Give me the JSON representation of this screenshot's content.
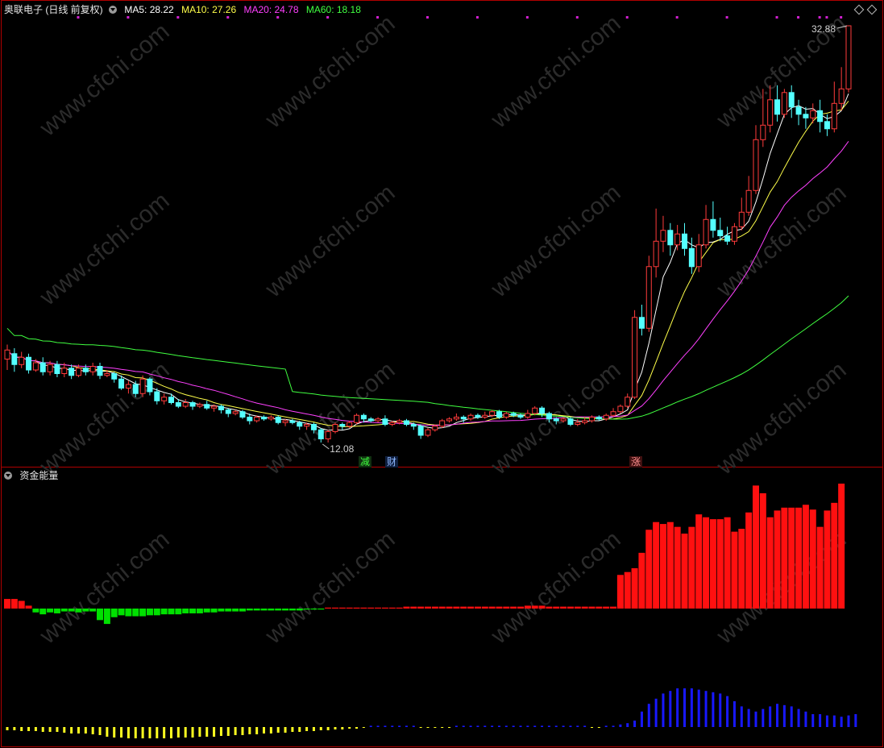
{
  "header": {
    "stock": "奥联电子 (日线 前复权)",
    "ma5": "MA5: 28.22",
    "ma10": "MA10: 27.26",
    "ma20": "MA20: 24.78",
    "ma60": "MA60: 18.18"
  },
  "indicator": {
    "title": "资金能量"
  },
  "annotations": {
    "high": "32.88",
    "low": "12.08"
  },
  "signals": [
    {
      "text": "减"
    },
    {
      "text": "财"
    },
    {
      "text": "涨"
    }
  ],
  "colors": {
    "up": "#ff3b3b",
    "down": "#54ffff",
    "ma5": "#ffffff",
    "ma10": "#ffff4a",
    "ma20": "#ff40ff",
    "ma60": "#40ff40",
    "frame": "#b00000",
    "energy_pos": "#ff1010",
    "energy_neg": "#00e000",
    "flow_blue": "#1818ff",
    "flow_yellow": "#ffff20"
  },
  "chart_data": {
    "type": "candlestick",
    "ylim": [
      12.08,
      32.88
    ],
    "candles": [
      [
        14.5,
        15.0,
        15.3,
        13.9
      ],
      [
        14.8,
        14.2,
        15.1,
        13.8
      ],
      [
        14.2,
        14.6,
        14.9,
        14.0
      ],
      [
        14.6,
        13.9,
        14.8,
        13.7
      ],
      [
        13.9,
        14.3,
        14.5,
        13.8
      ],
      [
        14.3,
        13.8,
        14.6,
        13.6
      ],
      [
        13.8,
        14.2,
        14.4,
        13.6
      ],
      [
        14.2,
        13.7,
        14.4,
        13.5
      ],
      [
        13.7,
        14.0,
        14.3,
        13.5
      ],
      [
        14.0,
        13.6,
        14.2,
        13.4
      ],
      [
        13.6,
        14.0,
        14.2,
        13.5
      ],
      [
        14.0,
        13.8,
        14.2,
        13.6
      ],
      [
        13.8,
        14.1,
        14.3,
        13.6
      ],
      [
        14.1,
        13.6,
        14.3,
        13.4
      ],
      [
        13.6,
        13.7,
        13.9,
        13.5
      ],
      [
        13.7,
        13.4,
        13.8,
        13.2
      ],
      [
        13.4,
        12.9,
        13.6,
        12.8
      ],
      [
        12.9,
        13.1,
        13.3,
        12.6
      ],
      [
        13.1,
        12.6,
        13.3,
        12.4
      ],
      [
        12.6,
        13.4,
        13.6,
        12.4
      ],
      [
        13.4,
        12.7,
        13.5,
        12.5
      ],
      [
        12.7,
        12.2,
        12.9,
        12.0
      ],
      [
        12.2,
        12.4,
        12.6,
        12.0
      ],
      [
        12.4,
        12.1,
        12.6,
        12.0
      ],
      [
        12.1,
        11.9,
        12.3,
        11.8
      ],
      [
        11.9,
        12.1,
        12.3,
        11.8
      ],
      [
        12.1,
        11.9,
        12.2,
        11.7
      ],
      [
        11.9,
        12.0,
        12.1,
        11.8
      ],
      [
        12.0,
        11.8,
        12.2,
        11.7
      ],
      [
        11.8,
        11.9,
        12.0,
        11.6
      ],
      [
        11.9,
        11.7,
        12.0,
        11.5
      ],
      [
        11.7,
        11.5,
        11.8,
        11.3
      ],
      [
        11.5,
        11.6,
        11.7,
        11.4
      ],
      [
        11.6,
        11.3,
        11.7,
        11.2
      ],
      [
        11.3,
        11.1,
        11.5,
        10.9
      ],
      [
        11.1,
        11.3,
        11.4,
        11.0
      ],
      [
        11.3,
        11.2,
        11.4,
        11.1
      ],
      [
        11.2,
        11.3,
        11.4,
        11.1
      ],
      [
        11.3,
        11.0,
        11.4,
        10.9
      ],
      [
        11.0,
        11.1,
        11.2,
        10.8
      ],
      [
        11.1,
        11.0,
        11.2,
        10.9
      ],
      [
        11.0,
        10.8,
        11.1,
        10.6
      ],
      [
        10.8,
        10.9,
        11.0,
        10.6
      ],
      [
        10.9,
        10.6,
        11.0,
        10.4
      ],
      [
        10.6,
        10.1,
        10.7,
        9.9
      ],
      [
        10.1,
        10.5,
        10.6,
        9.9
      ],
      [
        10.5,
        10.9,
        11.0,
        10.4
      ],
      [
        10.9,
        10.8,
        11.0,
        10.6
      ],
      [
        10.8,
        11.0,
        11.1,
        10.7
      ],
      [
        11.0,
        11.4,
        11.5,
        10.9
      ],
      [
        11.4,
        11.2,
        11.5,
        11.0
      ],
      [
        11.2,
        11.1,
        11.3,
        11.0
      ],
      [
        11.1,
        11.2,
        11.3,
        11.0
      ],
      [
        11.2,
        10.9,
        11.4,
        10.8
      ],
      [
        10.9,
        11.0,
        11.1,
        10.8
      ],
      [
        11.0,
        11.1,
        11.2,
        10.9
      ],
      [
        11.1,
        10.9,
        11.2,
        10.8
      ],
      [
        10.9,
        10.8,
        11.0,
        10.6
      ],
      [
        10.8,
        10.3,
        10.9,
        10.1
      ],
      [
        10.3,
        10.6,
        10.7,
        10.2
      ],
      [
        10.6,
        10.8,
        10.9,
        10.5
      ],
      [
        10.8,
        11.1,
        11.2,
        10.7
      ],
      [
        11.1,
        11.2,
        11.3,
        11.0
      ],
      [
        11.2,
        11.3,
        11.5,
        11.1
      ],
      [
        11.3,
        11.2,
        11.4,
        11.0
      ],
      [
        11.2,
        11.4,
        11.5,
        11.1
      ],
      [
        11.4,
        11.3,
        11.5,
        11.2
      ],
      [
        11.3,
        11.4,
        11.6,
        11.2
      ],
      [
        11.4,
        11.6,
        11.7,
        11.3
      ],
      [
        11.6,
        11.3,
        11.7,
        11.2
      ],
      [
        11.3,
        11.5,
        11.6,
        11.2
      ],
      [
        11.5,
        11.4,
        11.6,
        11.3
      ],
      [
        11.4,
        11.3,
        11.5,
        11.2
      ],
      [
        11.3,
        11.5,
        11.7,
        11.2
      ],
      [
        11.5,
        11.8,
        11.9,
        11.4
      ],
      [
        11.8,
        11.5,
        11.9,
        11.3
      ],
      [
        11.5,
        11.2,
        11.6,
        11.0
      ],
      [
        11.2,
        11.1,
        11.3,
        10.9
      ],
      [
        11.1,
        11.2,
        11.3,
        11.0
      ],
      [
        11.2,
        10.9,
        11.3,
        10.8
      ],
      [
        10.9,
        11.0,
        11.2,
        10.8
      ],
      [
        11.0,
        11.1,
        11.3,
        10.9
      ],
      [
        11.1,
        11.3,
        11.4,
        11.0
      ],
      [
        11.3,
        11.2,
        11.4,
        11.1
      ],
      [
        11.2,
        11.4,
        11.5,
        11.1
      ],
      [
        11.4,
        11.6,
        11.8,
        11.3
      ],
      [
        11.6,
        11.9,
        12.0,
        11.5
      ],
      [
        11.9,
        12.4,
        12.6,
        11.8
      ],
      [
        12.4,
        16.8,
        17.2,
        12.3
      ],
      [
        16.8,
        16.2,
        17.5,
        15.8
      ],
      [
        16.2,
        19.6,
        20.2,
        16.0
      ],
      [
        19.6,
        21.0,
        22.8,
        19.0
      ],
      [
        21.0,
        21.6,
        22.4,
        20.4
      ],
      [
        21.6,
        20.8,
        22.0,
        20.2
      ],
      [
        20.8,
        21.4,
        21.9,
        20.5
      ],
      [
        21.4,
        20.6,
        22.0,
        20.2
      ],
      [
        20.6,
        19.6,
        21.2,
        19.2
      ],
      [
        19.6,
        20.8,
        21.4,
        19.3
      ],
      [
        20.8,
        22.2,
        23.0,
        20.6
      ],
      [
        22.2,
        21.6,
        23.2,
        21.2
      ],
      [
        21.6,
        21.3,
        22.3,
        21.0
      ],
      [
        21.3,
        21.0,
        21.8,
        20.8
      ],
      [
        21.0,
        21.8,
        22.0,
        20.8
      ],
      [
        21.8,
        22.6,
        23.4,
        21.6
      ],
      [
        22.6,
        23.8,
        24.6,
        22.4
      ],
      [
        23.8,
        26.6,
        27.4,
        23.6
      ],
      [
        26.6,
        27.4,
        29.4,
        26.2
      ],
      [
        27.4,
        28.8,
        29.6,
        27.0
      ],
      [
        28.8,
        28.0,
        29.6,
        27.6
      ],
      [
        28.0,
        29.2,
        29.4,
        27.8
      ],
      [
        29.2,
        28.4,
        29.6,
        27.8
      ],
      [
        28.4,
        28.0,
        28.8,
        27.4
      ],
      [
        28.0,
        27.8,
        28.4,
        27.2
      ],
      [
        27.8,
        28.2,
        28.6,
        27.5
      ],
      [
        28.2,
        27.6,
        28.8,
        27.0
      ],
      [
        27.6,
        27.2,
        28.0,
        26.8
      ],
      [
        27.2,
        28.6,
        29.8,
        27.0
      ],
      [
        28.6,
        29.4,
        30.6,
        28.2
      ],
      [
        29.4,
        32.88,
        32.88,
        29.2
      ]
    ],
    "energy": [
      10,
      10,
      8,
      3,
      -4,
      -6,
      -4,
      -5,
      -3,
      -3,
      -4,
      -3,
      -3,
      -12,
      -16,
      -9,
      -7,
      -8,
      -8,
      -8,
      -7,
      -7,
      -6,
      -6,
      -6,
      -5,
      -5,
      -5,
      -4,
      -4,
      -3,
      -3,
      -3,
      -3,
      -2,
      -2,
      -2,
      -2,
      -2,
      -2,
      -2,
      -2,
      -1,
      -1,
      -1,
      1,
      1,
      1,
      1,
      1,
      1,
      1,
      1,
      1,
      1,
      1,
      2,
      2,
      2,
      2,
      2,
      2,
      2,
      2,
      2,
      2,
      2,
      2,
      2,
      2,
      2,
      2,
      2,
      3,
      3,
      3,
      2,
      2,
      2,
      2,
      2,
      2,
      2,
      2,
      2,
      2,
      35,
      38,
      42,
      58,
      82,
      90,
      88,
      90,
      85,
      78,
      85,
      98,
      95,
      93,
      93,
      95,
      80,
      83,
      100,
      128,
      120,
      95,
      102,
      105,
      105,
      105,
      108,
      103,
      85,
      102,
      110,
      130
    ],
    "flow": [
      4,
      4,
      5,
      5,
      5,
      6,
      6,
      6,
      7,
      8,
      8,
      8,
      9,
      10,
      12,
      13,
      13,
      14,
      14,
      14,
      14,
      14,
      14,
      14,
      13,
      13,
      13,
      12,
      12,
      12,
      11,
      11,
      10,
      10,
      9,
      9,
      8,
      8,
      7,
      7,
      6,
      6,
      5,
      5,
      4,
      4,
      3,
      3,
      2,
      2,
      1,
      -1,
      -1,
      -1,
      -1,
      -1,
      -1,
      -1,
      1,
      1,
      1,
      1,
      1,
      -1,
      -1,
      -1,
      -1,
      -1,
      -1,
      -1,
      -1,
      -1,
      -1,
      -1,
      -1,
      -1,
      -1,
      -1,
      -1,
      -1,
      -1,
      -1,
      1,
      1,
      -1,
      -1,
      -2,
      -3,
      -5,
      -12,
      -18,
      -22,
      -26,
      -28,
      -30,
      -30,
      -30,
      -29,
      -28,
      -27,
      -26,
      -24,
      -20,
      -16,
      -14,
      -12,
      -14,
      -16,
      -18,
      -17,
      -16,
      -14,
      -12,
      -10,
      -10,
      -9,
      -9,
      -8,
      -9,
      -10
    ]
  }
}
